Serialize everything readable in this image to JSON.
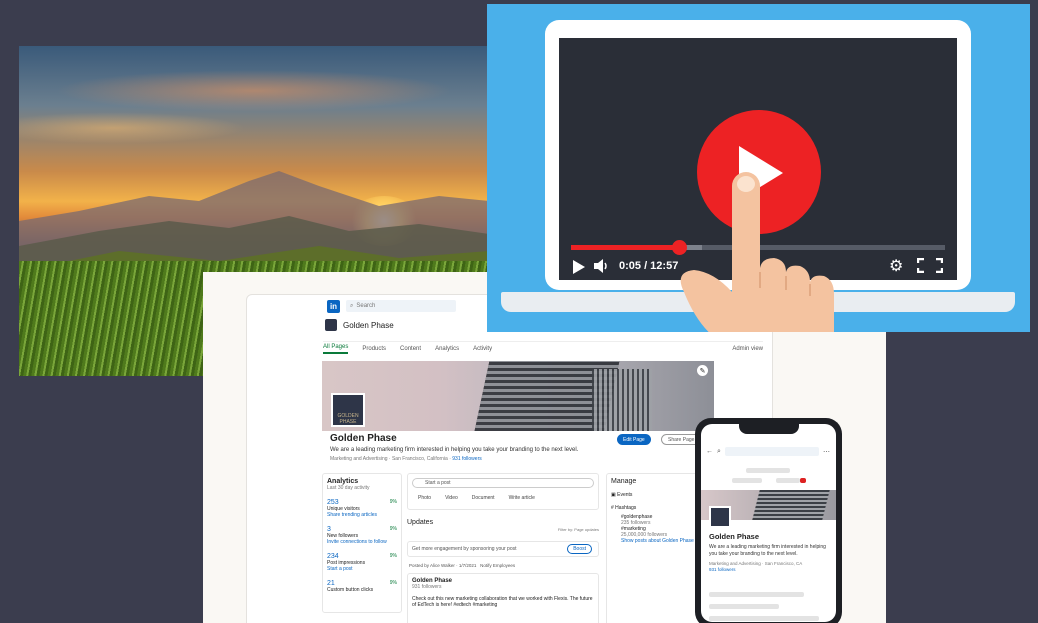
{
  "video": {
    "current_time": "0:05",
    "total_time": "12:57",
    "time_display": "0:05 / 12:57",
    "progress_fraction": 0.29,
    "buffer_fraction": 0.35,
    "accent_color": "#ed2224",
    "icons": [
      "play-icon",
      "volume-icon",
      "settings-icon",
      "fullscreen-icon",
      "hand-pointer-icon"
    ]
  },
  "linkedin": {
    "search_placeholder": "Search",
    "page_name": "Golden Phase",
    "tabs": [
      "All Pages",
      "Products",
      "Content",
      "Analytics",
      "Activity"
    ],
    "admin_view": "Admin view",
    "logo_text": "GOLDEN PHASE",
    "tagline": "We are a leading marketing firm interested in helping you take your branding to the next level.",
    "meta": "Marketing and Advertising · San Francisco, California ·",
    "followers_link": "931 followers",
    "edit_page": "Edit Page",
    "share_page": "Share Page",
    "analytics": {
      "title": "Analytics",
      "subtitle": "Last 30 day activity",
      "stats": [
        {
          "value": "253",
          "label": "Unique visitors",
          "link": "Share trending articles",
          "pct": "9%"
        },
        {
          "value": "3",
          "label": "New followers",
          "link": "Invite connections to follow",
          "pct": "9%"
        },
        {
          "value": "234",
          "label": "Post impressions",
          "link": "Start a post",
          "pct": "9%"
        },
        {
          "value": "21",
          "label": "Custom button clicks",
          "link": "",
          "pct": "9%"
        }
      ]
    },
    "composer": {
      "start_post": "Start a post",
      "actions": [
        "Photo",
        "Video",
        "Document",
        "Write article"
      ]
    },
    "updates_title": "Updates",
    "filter": "Filter by: Page updates",
    "engagement_text": "Get more engagement by sponsoring your post",
    "boost": "Boost",
    "posted_by": "Posted by Alice Walker · 1/7/2021",
    "notify": "Notify Employees",
    "post": {
      "author": "Golden Phase",
      "followers": "931 followers",
      "text": "Check out this new marketing collaboration that we worked with Flexis. The future of EdTech is here! #edtech #marketing"
    },
    "manage": {
      "title": "Manage",
      "events": "Events",
      "hashtags": "Hashtags",
      "tags": [
        {
          "tag": "#goldenphase",
          "count": "235 followers"
        },
        {
          "tag": "#marketing",
          "count": "25,000,000 followers"
        }
      ],
      "show_posts": "Show posts about Golden Phase"
    }
  },
  "phone": {
    "page_name": "Golden Phase",
    "tagline": "We are a leading marketing firm interested in helping you take your branding to the next level.",
    "meta": "Marketing and Advertising · San Francisco, CA",
    "followers": "931 followers"
  }
}
